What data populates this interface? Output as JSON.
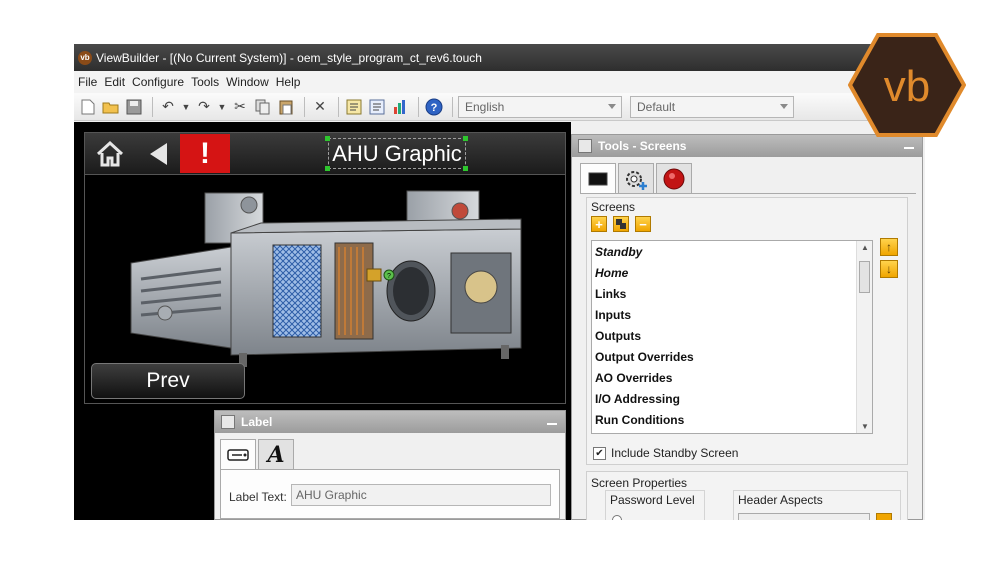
{
  "window": {
    "title": "ViewBuilder - [(No Current System)] - oem_style_program_ct_rev6.touch",
    "app_icon_text": "vb"
  },
  "menu": [
    "File",
    "Edit",
    "Configure",
    "Tools",
    "Window",
    "Help"
  ],
  "toolbar": {
    "language_value": "English",
    "style_value": "Default"
  },
  "touch_screen": {
    "header_title": "AHU Graphic",
    "alarm_symbol": "!",
    "prev_button": "Prev",
    "help_marker": "?"
  },
  "label_panel": {
    "title": "Label",
    "label_text_caption": "Label Text:",
    "label_text_value": "AHU Graphic",
    "tab_font_glyph": "A"
  },
  "tools_panel": {
    "title": "Tools - Screens",
    "screens_caption": "Screens",
    "screens": [
      "Standby",
      "Home",
      "Links",
      "Inputs",
      "Outputs",
      "Output Overrides",
      "AO Overrides",
      "I/O Addressing",
      "Run Conditions"
    ],
    "italic_screens": [
      "Standby",
      "Home"
    ],
    "include_standby_label": "Include Standby Screen",
    "include_standby_checked": true,
    "screen_properties_caption": "Screen Properties",
    "password_level_caption": "Password Level",
    "header_aspects_caption": "Header Aspects"
  },
  "logo": {
    "text": "vb"
  },
  "colors": {
    "alarm_red": "#d51414",
    "logo_orange": "#e08a2c",
    "logo_dark": "#3a2418",
    "button_gold": "#f0a500"
  }
}
